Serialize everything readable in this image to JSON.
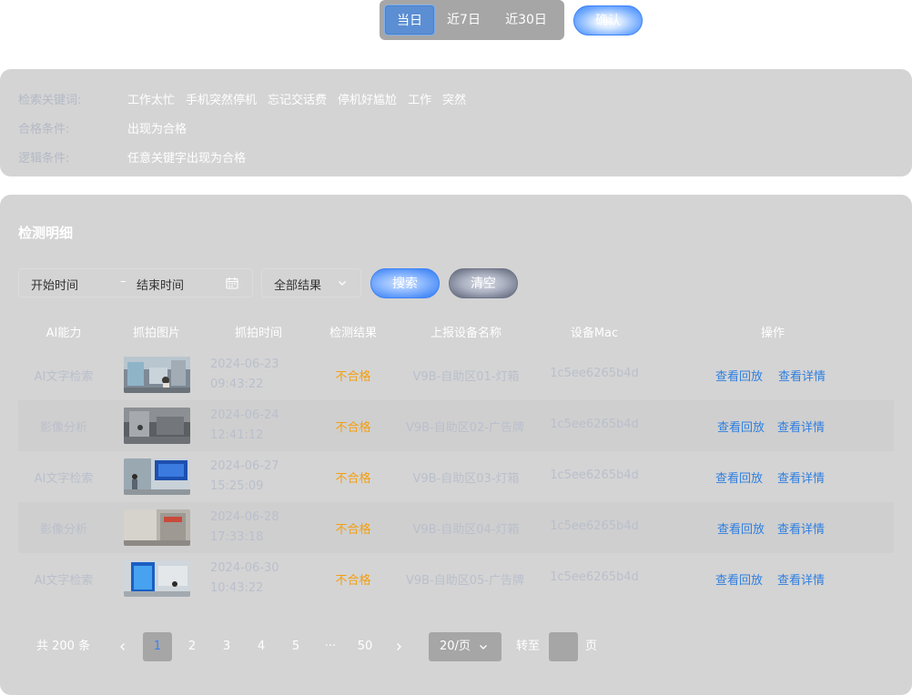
{
  "time_filter": {
    "options": [
      "当日",
      "近7日",
      "近30日"
    ],
    "active": "当日",
    "confirm_label": "确认"
  },
  "conditions": {
    "keywords_label": "检索关键词:",
    "keywords": [
      "工作太忙",
      "手机突然停机",
      "忘记交话费",
      "停机好尴尬",
      "工作",
      "突然"
    ],
    "pass_label": "合格条件:",
    "pass_value": "出现为合格",
    "logic_label": "逻辑条件:",
    "logic_value": "任意关键字出现为合格"
  },
  "detail": {
    "title": "检测明细",
    "filters": {
      "start_placeholder": "开始时间",
      "separator": "–",
      "end_placeholder": "结束时间",
      "result_select": "全部结果",
      "search_label": "搜索",
      "clear_label": "清空"
    },
    "columns": [
      "AI能力",
      "抓拍图片",
      "抓拍时间",
      "检测结果",
      "上报设备名称",
      "设备Mac",
      "操作"
    ],
    "rows": [
      {
        "ability": "AI文字检索",
        "date": "2024-06-23",
        "time": "09:43:22",
        "result": "不合格",
        "device": "V9B-自助区01-灯箱",
        "mac": "1c5ee6265b4d",
        "replay": "查看回放",
        "detail": "查看详情"
      },
      {
        "ability": "影像分析",
        "date": "2024-06-24",
        "time": "12:41:12",
        "result": "不合格",
        "device": "V9B-自助区02-广告牌",
        "mac": "1c5ee6265b4d",
        "replay": "查看回放",
        "detail": "查看详情"
      },
      {
        "ability": "AI文字检索",
        "date": "2024-06-27",
        "time": "15:25:09",
        "result": "不合格",
        "device": "V9B-自助区03-灯箱",
        "mac": "1c5ee6265b4d",
        "replay": "查看回放",
        "detail": "查看详情"
      },
      {
        "ability": "影像分析",
        "date": "2024-06-28",
        "time": "17:33:18",
        "result": "不合格",
        "device": "V9B-自助区04-灯箱",
        "mac": "1c5ee6265b4d",
        "replay": "查看回放",
        "detail": "查看详情"
      },
      {
        "ability": "AI文字检索",
        "date": "2024-06-30",
        "time": "10:43:22",
        "result": "不合格",
        "device": "V9B-自助区05-广告牌",
        "mac": "1c5ee6265b4d",
        "replay": "查看回放",
        "detail": "查看详情"
      }
    ]
  },
  "pagination": {
    "total": "共 200 条",
    "pages": [
      "1",
      "2",
      "3",
      "4",
      "5",
      "···",
      "50"
    ],
    "current": "1",
    "page_size": "20/页",
    "jump_label": "转至",
    "page_suffix": "页"
  },
  "colors": {
    "accent": "#3b82f6",
    "fail": "#f59e0b",
    "link": "#2f7fe0",
    "panel": "#d4d4d4"
  }
}
